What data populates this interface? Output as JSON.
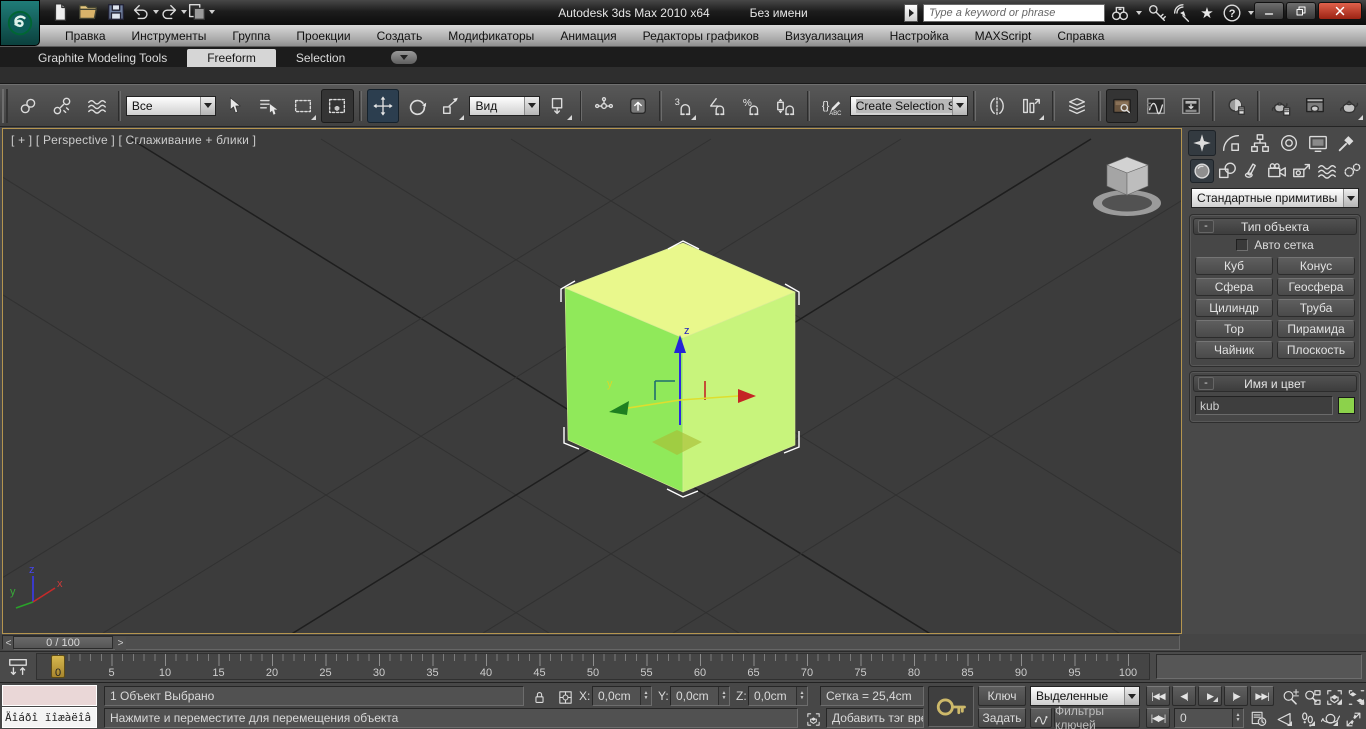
{
  "titlebar": {
    "title": "Autodesk 3ds Max  2010 x64",
    "document": "Без имени",
    "search_placeholder": "Type a keyword or phrase"
  },
  "menubar": {
    "items": [
      "Правка",
      "Инструменты",
      "Группа",
      "Проекции",
      "Создать",
      "Модификаторы",
      "Анимация",
      "Редакторы графиков",
      "Визуализация",
      "Настройка",
      "MAXScript",
      "Справка"
    ]
  },
  "ribbon": {
    "tabs": [
      "Graphite Modeling Tools",
      "Freeform",
      "Selection"
    ],
    "active_tab": "Freeform"
  },
  "toolbar": {
    "selection_filter": "Все",
    "coord_system": "Вид",
    "named_sets": "Create Selection Se"
  },
  "viewport": {
    "label": "[ + ] [ Perspective ] [ Сглаживание + блики ]"
  },
  "command_panel": {
    "category_dropdown": "Стандартные примитивы",
    "object_type": {
      "collapse": "-",
      "title": "Тип объекта",
      "autogrid": "Авто сетка",
      "buttons": [
        "Куб",
        "Конус",
        "Сфера",
        "Геосфера",
        "Цилиндр",
        "Труба",
        "Тор",
        "Пирамида",
        "Чайник",
        "Плоскость"
      ]
    },
    "name_color": {
      "collapse": "-",
      "title": "Имя и цвет",
      "name": "kub",
      "color": "#8cd24b"
    }
  },
  "timeline": {
    "slider": "0 / 100",
    "prev": "<",
    "next": ">",
    "current_frame": 0,
    "ticks": [
      0,
      5,
      10,
      15,
      20,
      25,
      30,
      35,
      40,
      45,
      50,
      55,
      60,
      65,
      70,
      75,
      80,
      85,
      90,
      95,
      100
    ]
  },
  "statusbar": {
    "listener_output": "Äîáðî ïîæàëîâ",
    "selection_status": "1 Объект Выбрано",
    "prompt": "Нажмите и переместите для перемещения объекта",
    "x_label": "X:",
    "x_value": "0,0cm",
    "y_label": "Y:",
    "y_value": "0,0cm",
    "z_label": "Z:",
    "z_value": "0,0cm",
    "grid_info": "Сетка = 25,4cm",
    "add_time_tag": "Добавить тэг врем",
    "auto_key": "Ключ",
    "set_key": "Задать",
    "key_filter_scope": "Выделенные",
    "key_filters": "Фильтры ключей",
    "frame_value": "0",
    "playback": {
      "to_start": "|◀◀",
      "prev": "◀|",
      "play": "▶",
      "next": "|▶",
      "to_end": "▶▶|",
      "key_mode": "|◀▶|"
    }
  },
  "colors": {
    "viewport_border": "#b5954f",
    "cube_top": "#e9f88c",
    "cube_left": "#90e95a",
    "cube_right": "#c8f47c",
    "name_swatch": "#8cd24b",
    "close_button": "#b03020"
  }
}
